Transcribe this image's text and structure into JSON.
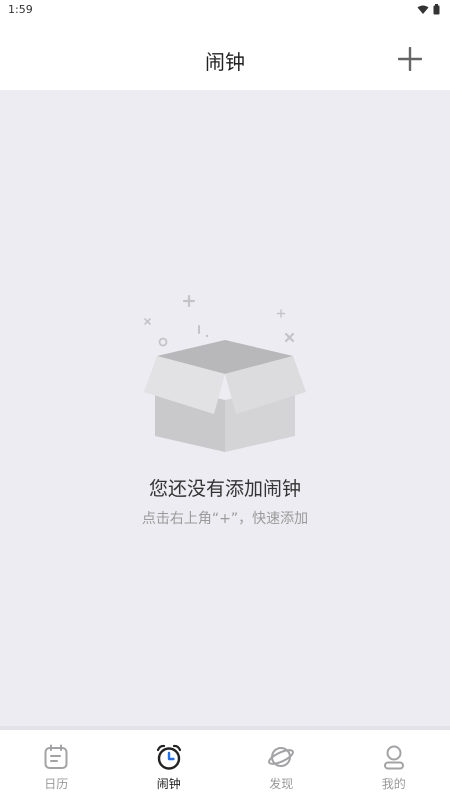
{
  "status_bar": {
    "time": "1:59"
  },
  "header": {
    "title": "闹钟",
    "add_icon": "plus-icon"
  },
  "empty_state": {
    "illustration": "empty-box-icon",
    "title": "您还没有添加闹钟",
    "hint": "点击右上角“+”，快速添加"
  },
  "tabs": [
    {
      "label": "日历",
      "icon": "calendar-icon",
      "active": false
    },
    {
      "label": "闹钟",
      "icon": "alarm-clock-icon",
      "active": true
    },
    {
      "label": "发现",
      "icon": "planet-icon",
      "active": false
    },
    {
      "label": "我的",
      "icon": "person-icon",
      "active": false
    }
  ],
  "colors": {
    "accent": "#1e6ff2",
    "background": "#edecf2",
    "tab_inactive": "#999999"
  }
}
